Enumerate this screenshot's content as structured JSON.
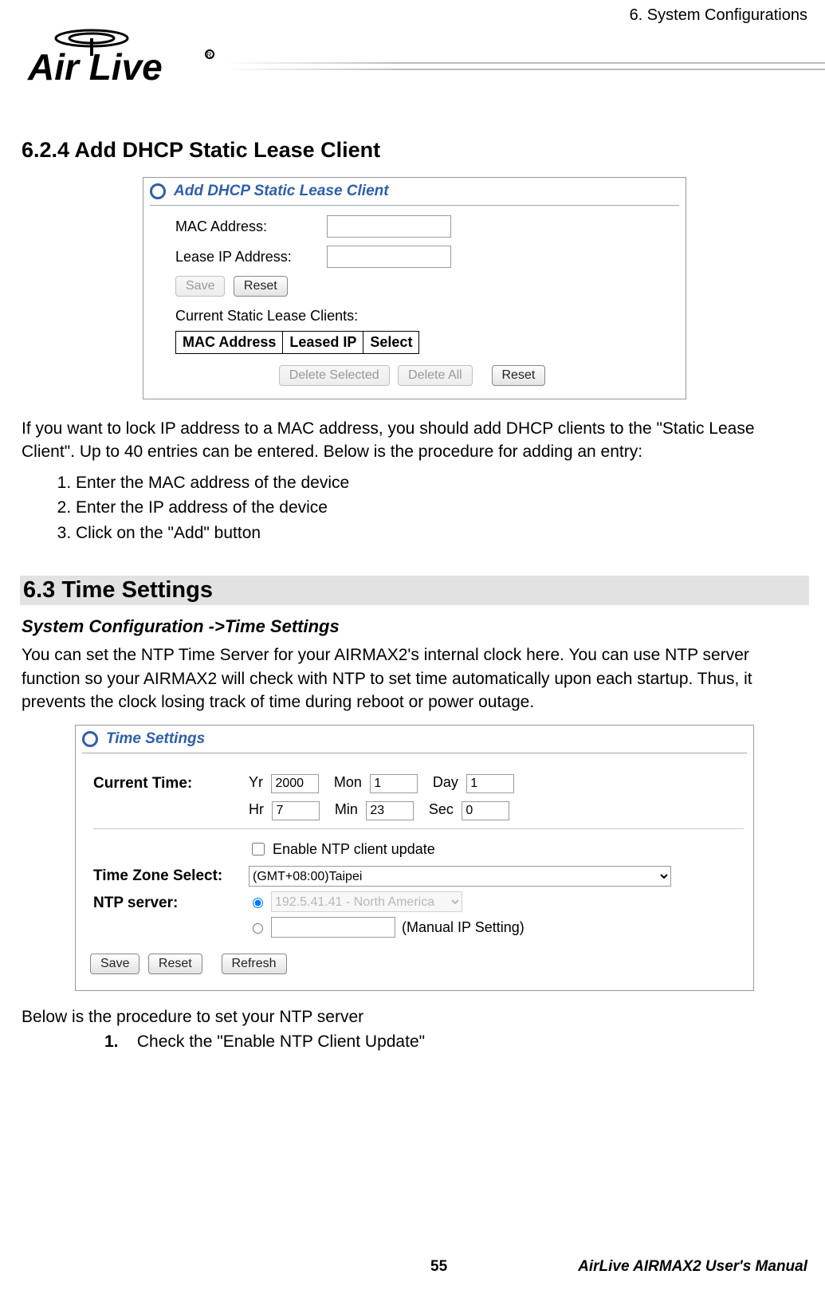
{
  "header": {
    "chapter": "6.  System Configurations"
  },
  "logo": {
    "brand_line1": "Air",
    "brand_line2": "Live"
  },
  "sec624": {
    "title": "6.2.4 Add DHCP Static Lease Client",
    "panel": {
      "heading": "Add DHCP Static Lease Client",
      "mac_label": "MAC Address:",
      "ip_label": "Lease IP Address:",
      "save": "Save",
      "reset": "Reset",
      "current_label": "Current Static Lease Clients:",
      "cols": [
        "MAC Address",
        "Leased IP",
        "Select"
      ],
      "del_sel": "Delete Selected",
      "del_all": "Delete All",
      "reset2": "Reset"
    },
    "intro": "If you want to lock IP address to a MAC address, you should add DHCP clients to the \"Static Lease Client\".    Up to 40 entries can be entered.    Below is the procedure for adding an entry:",
    "steps": [
      "Enter the MAC address of the device",
      "Enter the IP address of the device",
      "Click on the \"Add\" button"
    ]
  },
  "sec63": {
    "title": "6.3 Time  Settings",
    "path": "System Configuration ->Time Settings",
    "intro": "You can set the NTP Time Server for your AIRMAX2's internal clock here.    You can use NTP server function so your AIRMAX2 will check with NTP to set time automatically upon each startup.    Thus, it prevents the clock losing track of time during reboot or power outage.",
    "panel": {
      "heading": "Time Settings",
      "current_time": "Current Time:",
      "yr_l": "Yr",
      "yr_v": "2000",
      "mon_l": "Mon",
      "mon_v": "1",
      "day_l": "Day",
      "day_v": "1",
      "hr_l": "Hr",
      "hr_v": "7",
      "min_l": "Min",
      "min_v": "23",
      "sec_l": "Sec",
      "sec_v": "0",
      "enable_ntp": "Enable NTP client update",
      "tz_label": "Time Zone Select:",
      "tz_value": "(GMT+08:00)Taipei",
      "ntp_label": "NTP server:",
      "ntp_preset": "192.5.41.41 - North America",
      "ntp_manual_lbl": "(Manual IP Setting)",
      "save": "Save",
      "reset": "Reset",
      "refresh": "Refresh"
    },
    "below": "Below is the procedure to set your NTP server",
    "steps": [
      {
        "num": "1.",
        "text": "Check the \"Enable NTP Client Update\""
      }
    ]
  },
  "footer": {
    "page": "55",
    "manual": "AirLive AIRMAX2 User's Manual"
  }
}
